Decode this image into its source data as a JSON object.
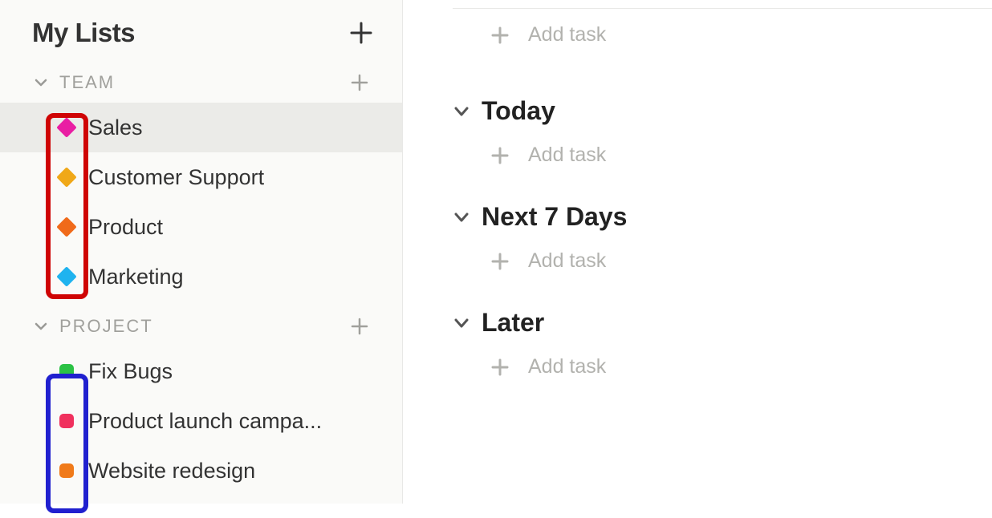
{
  "sidebar": {
    "title": "My Lists",
    "sections": [
      {
        "label": "TEAM",
        "markerShape": "diamond",
        "highlightColor": "red",
        "items": [
          {
            "label": "Sales",
            "color": "#e91ea3",
            "selected": true
          },
          {
            "label": "Customer Support",
            "color": "#f0a818",
            "selected": false
          },
          {
            "label": "Product",
            "color": "#f06a1a",
            "selected": false
          },
          {
            "label": "Marketing",
            "color": "#1fb3ef",
            "selected": false
          }
        ]
      },
      {
        "label": "PROJECT",
        "markerShape": "square",
        "highlightColor": "blue",
        "items": [
          {
            "label": "Fix Bugs",
            "color": "#2bc245",
            "selected": false
          },
          {
            "label": "Product launch campa...",
            "color": "#f0305d",
            "selected": false
          },
          {
            "label": "Website redesign",
            "color": "#f07a1a",
            "selected": false
          }
        ]
      }
    ]
  },
  "main": {
    "addTaskLabel": "Add task",
    "sections": [
      {
        "title": "Today"
      },
      {
        "title": "Next 7 Days"
      },
      {
        "title": "Later"
      }
    ]
  }
}
